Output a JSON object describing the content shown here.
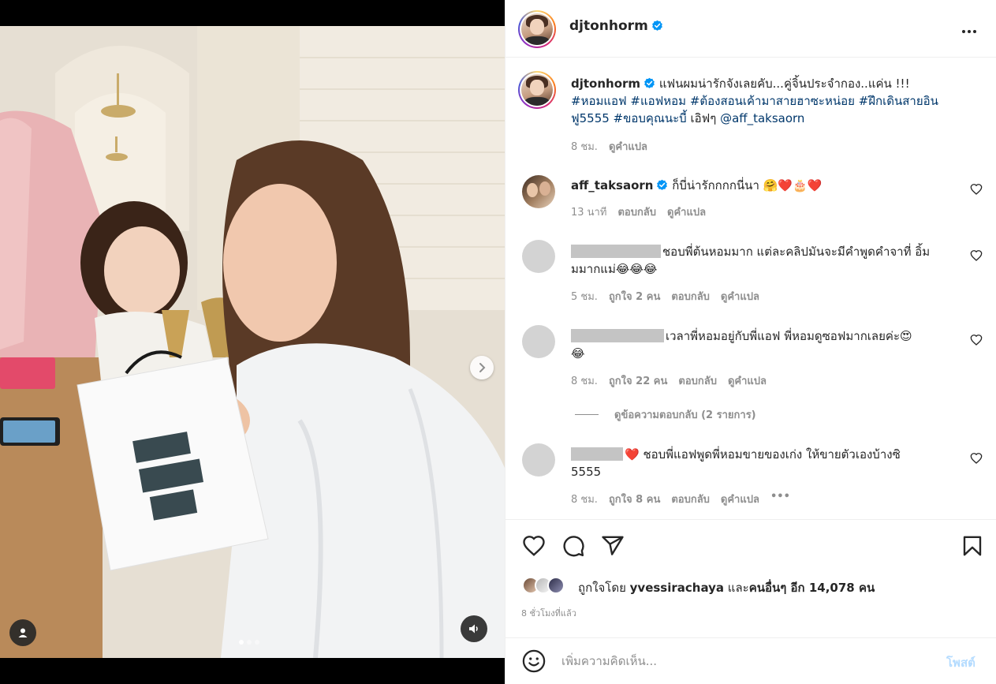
{
  "post": {
    "username": "djtonhorm",
    "caption_text": "แฟนผมน่ารักจังเลยคับ...คู่จิ้นประจำกอง..แค่น !!!",
    "caption_tags_line1": "#หอมแอฟ #แอฟหอม #ต้องสอนเค้ามาสายฮาซะหน่อย #ฝึกเดินสายอิน",
    "caption_tags_line2a": "ฟู5555 #ขอบคุณนะบี้",
    "caption_tags_line2b": " เอิฟๆ ",
    "caption_mention": "@aff_taksaorn",
    "caption_time": "8 ชม.",
    "caption_translate": "ดูคำแปล",
    "more_icon": "more-horizontal-icon",
    "verified_color": "#0095f6"
  },
  "comments": [
    {
      "username": "aff_taksaorn",
      "text": "ก็บี่น่ารักกกกนี่นา 🤗❤️🎂❤️",
      "time": "13 นาที",
      "reply": "ตอบกลับ",
      "translate": "ดูคำแปล"
    },
    {
      "username": "",
      "text_line1": "ชอบพี่ต้นหอมมาก แต่ละคลิปมันจะมีคำพูดคำจาที่ อิ้ม",
      "text_line2": "มมากแม่😂😂😂",
      "time": "5 ชม.",
      "likes": "ถูกใจ 2 คน",
      "reply": "ตอบกลับ",
      "translate": "ดูคำแปล"
    },
    {
      "username": "",
      "text_line1": "เวลาพี่หอมอยู่กับพี่แอฟ พี่หอมดูซอฟมากเลยค่ะ😍",
      "text_line2": "😂",
      "time": "8 ชม.",
      "likes": "ถูกใจ 22 คน",
      "reply": "ตอบกลับ",
      "translate": "ดูคำแปล",
      "view_replies": "ดูข้อความตอบกลับ (2 รายการ)"
    },
    {
      "username": "",
      "text_line1": "❤️ ชอบพี่แอฟพูดพี่หอมขายของเก่ง ให้ขายตัวเองบ้างซิ",
      "text_line2": "5555",
      "time": "8 ชม.",
      "likes": "ถูกใจ 8 คน",
      "reply": "ตอบกลับ",
      "translate": "ดูคำแปล",
      "more": "•••"
    }
  ],
  "actions": {
    "like_icon": "heart-icon",
    "comment_icon": "comment-icon",
    "share_icon": "share-icon",
    "save_icon": "bookmark-icon"
  },
  "likes": {
    "prefix": "ถูกใจโดย ",
    "liker": "yvessirachaya",
    "middle": " และ",
    "others": "คนอื่นๆ อีก 14,078 คน"
  },
  "posted_ago": "8 ชั่วโมงที่แล้ว",
  "add_comment": {
    "placeholder": "เพิ่มความคิดเห็น...",
    "post_label": "โพสต์",
    "emoji_icon": "smiley-icon"
  },
  "media": {
    "next_icon": "chevron-right-icon",
    "tag_icon": "user-tag-icon",
    "sound_icon": "speaker-icon",
    "slide_index": 1,
    "slide_count": 3
  }
}
